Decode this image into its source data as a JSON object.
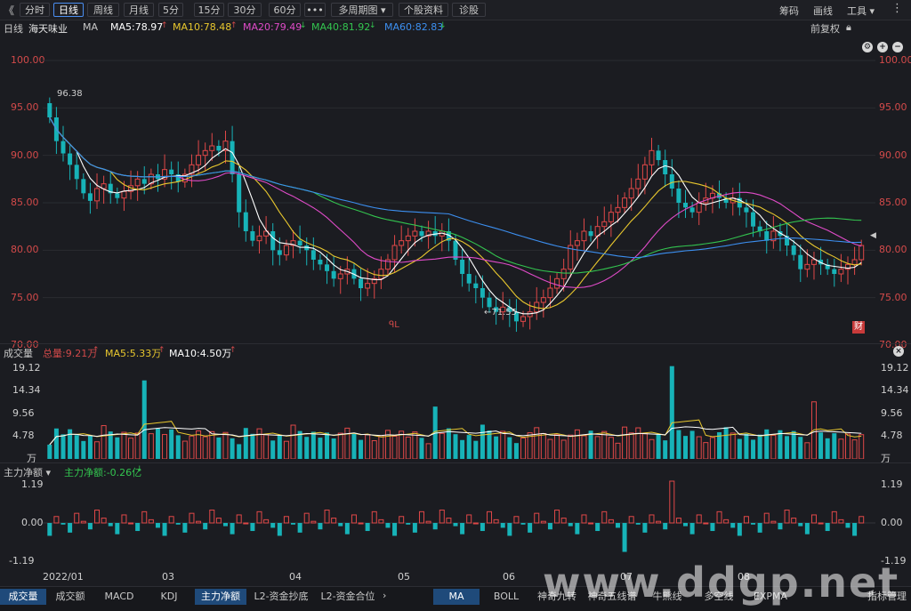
{
  "toolbar": {
    "back_icon": "double-chevron-left-icon",
    "periods": [
      "分时",
      "日线",
      "周线",
      "月线",
      "5分",
      "15分",
      "30分",
      "60分",
      "•••",
      "多周期图 ▾",
      "个股资料",
      "诊股"
    ],
    "active_period": "日线",
    "right": [
      "筹码",
      "画线",
      "工具 ▾"
    ]
  },
  "info": {
    "period": "日线",
    "stock_name": "海天味业",
    "ma_label": "MA",
    "ma5": "MA5:78.97",
    "ma10": "MA10:78.48",
    "ma20": "MA20:79.49",
    "ma40": "MA40:81.92",
    "ma60": "MA60:82.83",
    "adjust": "前复权",
    "colors": {
      "ma5": "#ffffff",
      "ma10": "#e8c72e",
      "ma20": "#e04bc8",
      "ma40": "#33c44f",
      "ma60": "#3c8ff0"
    }
  },
  "price_axis": {
    "ticks": [
      "100.00",
      "95.00",
      "90.00",
      "85.00",
      "80.00",
      "75.00",
      "70.00"
    ],
    "high_label": "96.38",
    "low_label": "←71.55",
    "finance_badge": "财",
    "marker_label": "ᑫL"
  },
  "volume_panel": {
    "title": "成交量",
    "total": "总量:9.21万",
    "ma5": "MA5:5.33万",
    "ma10": "MA10:4.50万",
    "ticks": [
      "19.12",
      "14.34",
      "9.56",
      "4.78",
      "万"
    ]
  },
  "flow_panel": {
    "title": "主力净额 ▾",
    "value": "主力净额:-0.26亿",
    "ticks": [
      "1.19",
      "0.00",
      "-1.19"
    ]
  },
  "x_axis": [
    "2022/01",
    "03",
    "04",
    "05",
    "06",
    "07",
    "08"
  ],
  "bottom_tabs_left": [
    "成交量",
    "成交额",
    "MACD",
    "KDJ",
    "主力净额",
    "L2-资金抄底",
    "L2-资金合位"
  ],
  "bottom_tabs_right": [
    "MA",
    "BOLL",
    "神奇九转",
    "神奇五线谱",
    "牛熊线",
    "多空线",
    "EXPMA",
    "指标管理"
  ],
  "watermark": "www.ddgp.net",
  "chart_data": {
    "type": "candlestick",
    "ylim": [
      70,
      100
    ],
    "dates_span": "2022/01 – 2022/08",
    "close": [
      94.0,
      91.5,
      90.2,
      89.0,
      87.5,
      86.0,
      85.2,
      86.5,
      87.0,
      86.0,
      85.5,
      86.2,
      86.8,
      87.5,
      87.0,
      88.0,
      87.5,
      88.5,
      88.0,
      87.2,
      88.0,
      89.0,
      90.0,
      90.5,
      91.0,
      90.5,
      91.5,
      88.0,
      84.0,
      82.0,
      81.0,
      81.5,
      82.0,
      80.0,
      79.5,
      80.5,
      81.0,
      80.5,
      80.0,
      79.0,
      78.5,
      77.8,
      77.0,
      77.5,
      78.0,
      77.0,
      76.0,
      76.5,
      77.0,
      78.0,
      79.0,
      80.5,
      81.0,
      81.5,
      82.0,
      81.5,
      82.0,
      81.5,
      82.0,
      81.0,
      79.0,
      77.5,
      76.5,
      76.0,
      75.0,
      74.0,
      73.5,
      74.0,
      73.5,
      72.5,
      73.0,
      73.5,
      74.5,
      75.0,
      76.0,
      77.0,
      78.0,
      80.5,
      81.0,
      82.0,
      81.5,
      82.5,
      83.0,
      84.0,
      84.5,
      85.5,
      86.5,
      87.5,
      89.0,
      90.5,
      89.5,
      88.0,
      86.5,
      85.0,
      84.5,
      84.0,
      85.0,
      85.5,
      86.0,
      85.5,
      85.0,
      85.5,
      84.5,
      84.0,
      82.5,
      82.0,
      81.0,
      82.0,
      81.5,
      80.5,
      79.5,
      78.0,
      78.5,
      79.0,
      78.5,
      78.0,
      77.5,
      78.0,
      78.5,
      79.0,
      80.5
    ],
    "volume_ticks": [
      4.78,
      9.56,
      14.34,
      19.12
    ],
    "volume_unit": "万",
    "flow_ticks": [
      -1.19,
      0.0,
      1.19
    ],
    "ma5_last": 78.97,
    "ma10_last": 78.48,
    "ma20_last": 79.49,
    "ma40_last": 81.92,
    "ma60_last": 82.83,
    "high": 96.38,
    "low": 71.55,
    "volume_total": "9.21万",
    "flow_last": "-0.26亿"
  }
}
